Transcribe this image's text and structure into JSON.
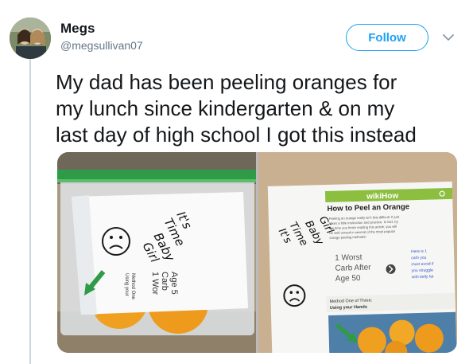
{
  "author": {
    "name": "Megs",
    "handle": "@megsullivan07"
  },
  "actions": {
    "follow_label": "Follow"
  },
  "tweet": {
    "lines": [
      "My dad has been peeling oranges for",
      "my lunch since kindergarten & on my",
      "last day of high school I got this instead"
    ]
  },
  "photo_left": {
    "note_handwriting": [
      "It's",
      "Time",
      "Baby",
      "Girl"
    ],
    "printed_fragments": [
      "1 Wor",
      "Carb",
      "Age 5",
      "Method One",
      "Using your"
    ]
  },
  "photo_right": {
    "site_name": "wikiHow",
    "article_title": "How to Peel an Orange",
    "intro_text": [
      "Peeling an orange really isn't that difficult. It just",
      "takes a little instruction and practice. In fact, by",
      "the time you finish reading this article, you will",
      "be well versed in several of the most popular",
      "orange peeling methods!"
    ],
    "ad_lines": [
      "1 Worst",
      "Carb After",
      "Age 50"
    ],
    "ad_side_text": [
      "Here is 1",
      "carb you",
      "must avoid if",
      "you struggle",
      "with belly fat"
    ],
    "method_lines": [
      "Method One of Three:",
      "Using your Hands"
    ],
    "note_handwriting": [
      "It's",
      "Time",
      "Baby",
      "Girl"
    ]
  },
  "colors": {
    "follow_blue": "#1da1f2",
    "wikihow_green": "#8cbf3f",
    "ziplock_green": "#2f9a47",
    "orange": "#f0a020"
  }
}
